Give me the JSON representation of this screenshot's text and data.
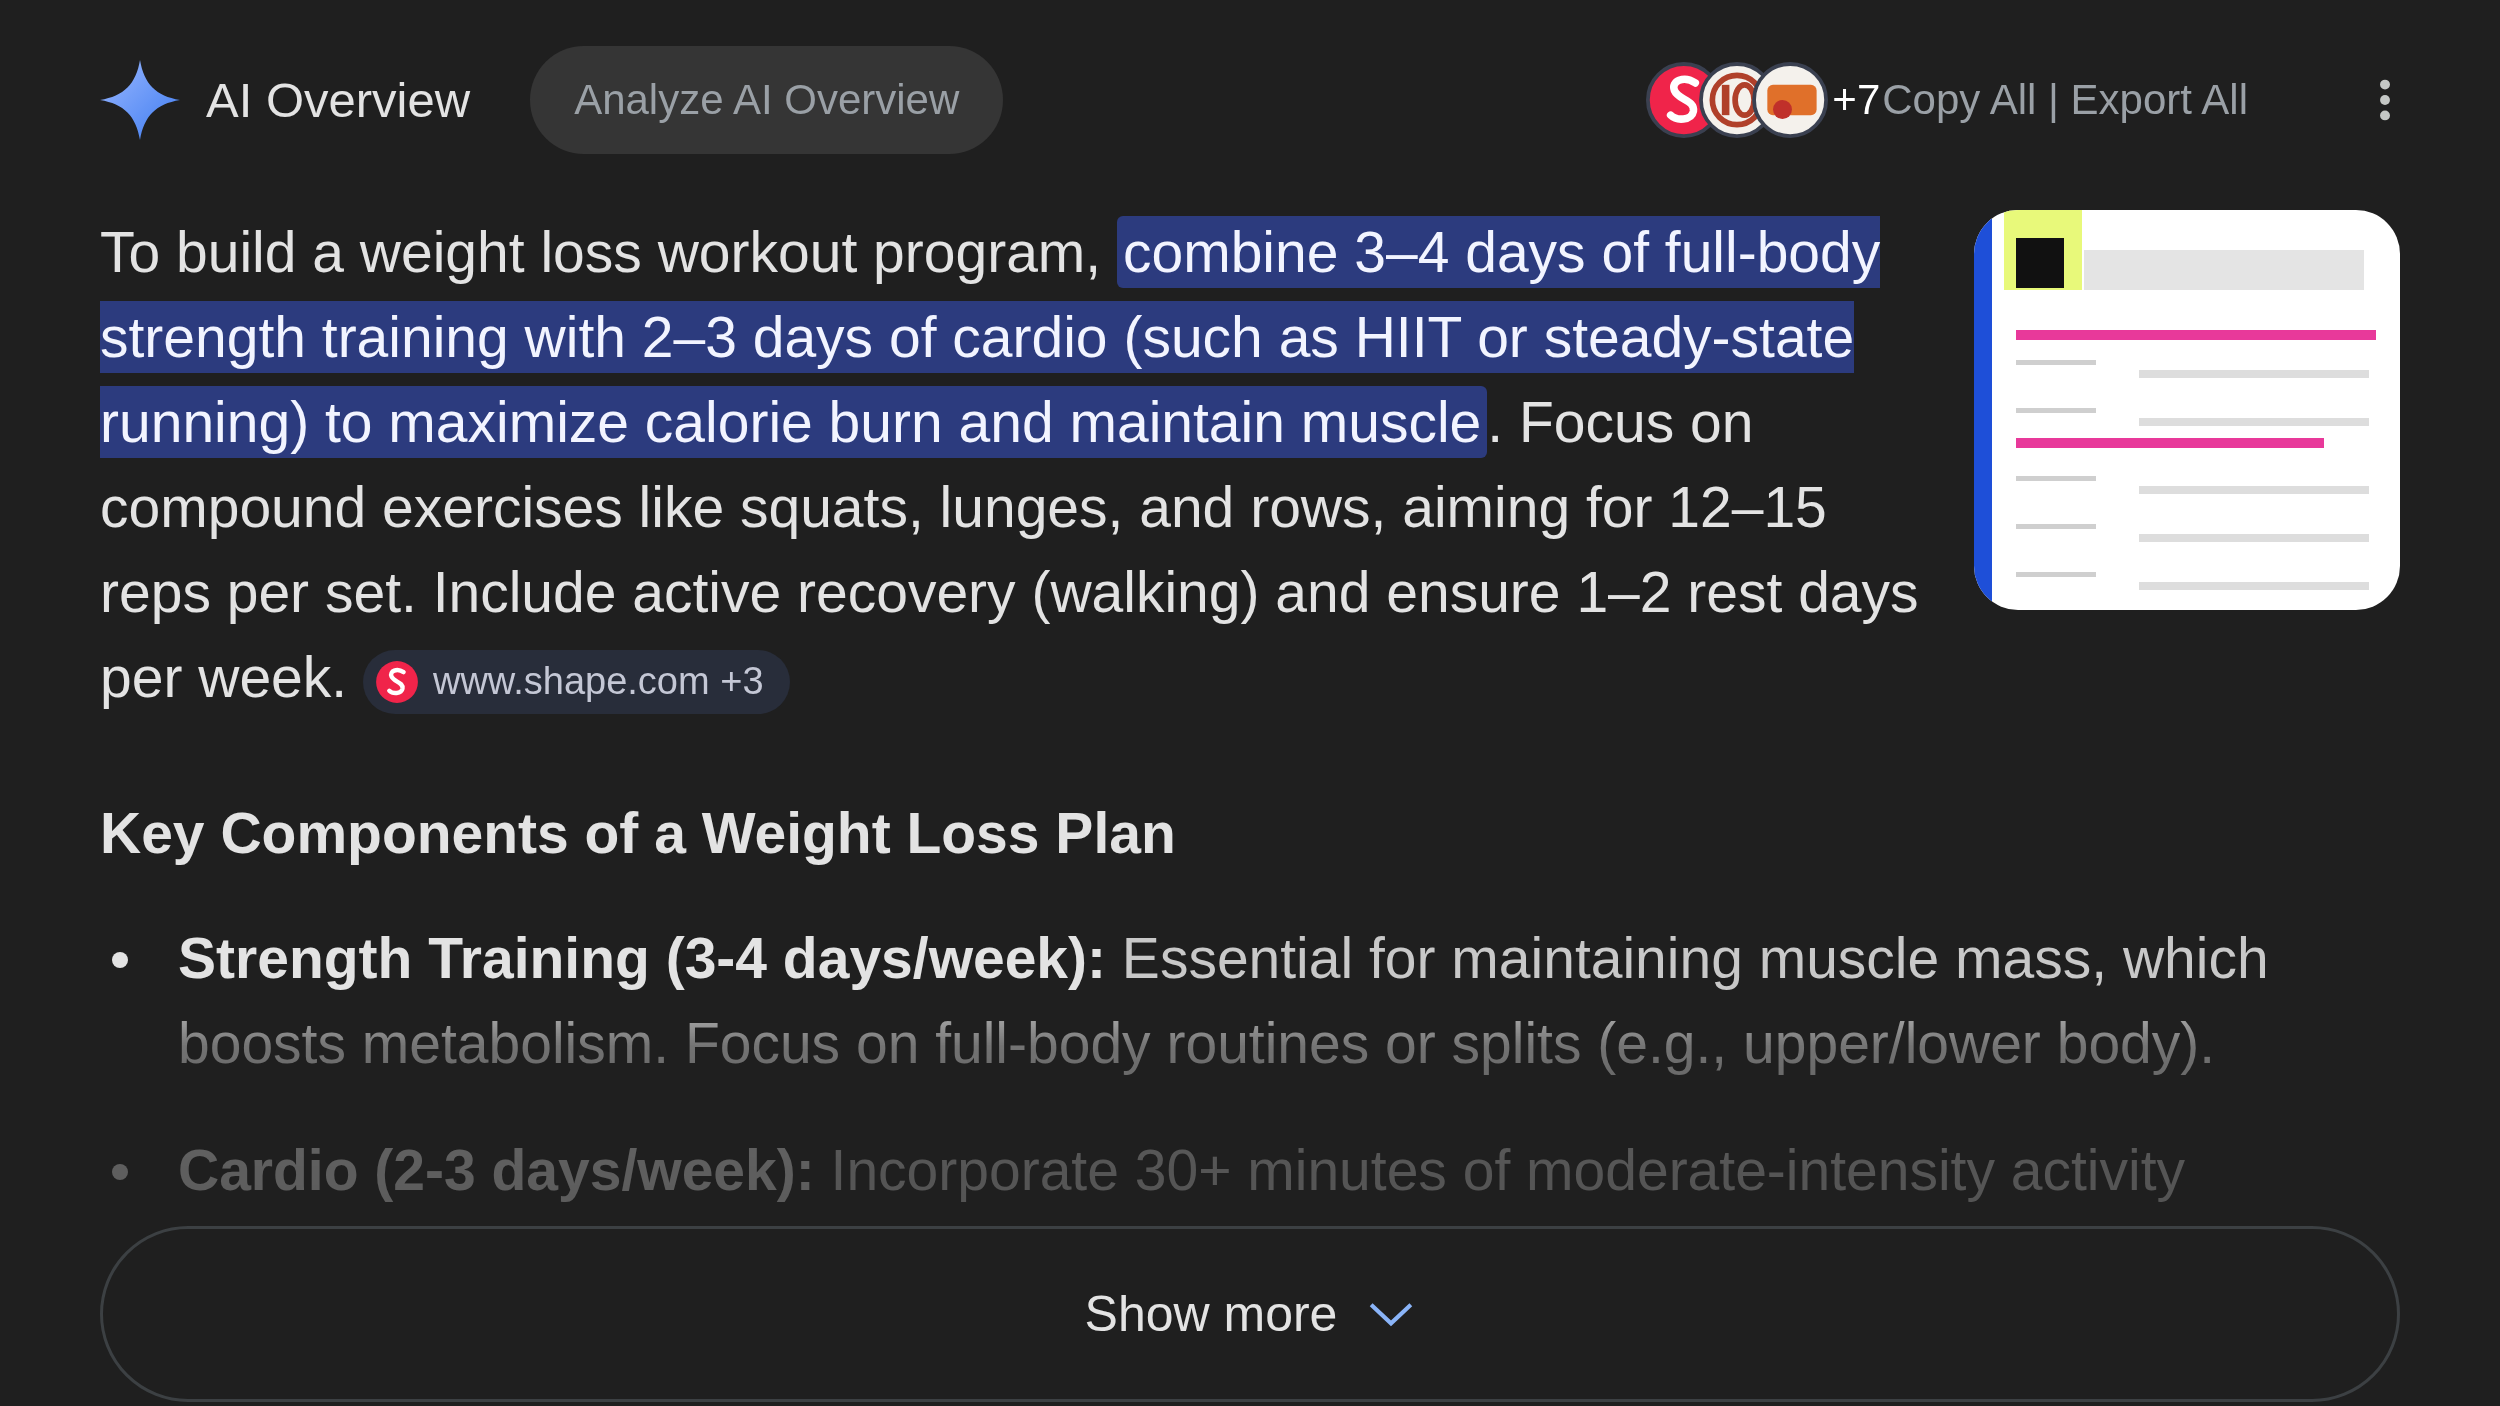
{
  "header": {
    "title": "AI Overview",
    "analyze_button": "Analyze AI Overview",
    "sources": [
      {
        "color": "#f0244a",
        "kind": "s"
      },
      {
        "color": "#b0402a",
        "kind": "ring"
      },
      {
        "color": "#e0702a",
        "kind": "badge"
      }
    ],
    "source_count": "+7",
    "actions": "Copy All | Export All"
  },
  "summary": {
    "parts": [
      {
        "text": "To build a weight loss workout program, ",
        "highlighted": false
      },
      {
        "text": "combine 3–4 days of full-body strength training with 2–3 days of cardio (such as HIIT or steady-state running) to maximize calorie burn and maintain muscle",
        "highlighted": true
      },
      {
        "text": ". Focus on compound exercises like squats, lunges, and rows, aiming for 12–15 reps per set. Include active recovery (walking) and ensure 1–2 rest days per week. ",
        "highlighted": false
      }
    ],
    "citation": "www.shape.com +3"
  },
  "section_heading": "Key Components of a Weight Loss Plan",
  "bullets": [
    {
      "text": "**Strength Training (3-4 days/week):** Essential for maintaining muscle mass, which boosts metabolism. Focus on full-body routines or splits (e.g., upper/lower body)."
    },
    {
      "text": "**Cardio (2-3 days/week):** Incorporate 30+ minutes of moderate-intensity activity"
    }
  ],
  "show_more": "Show more"
}
